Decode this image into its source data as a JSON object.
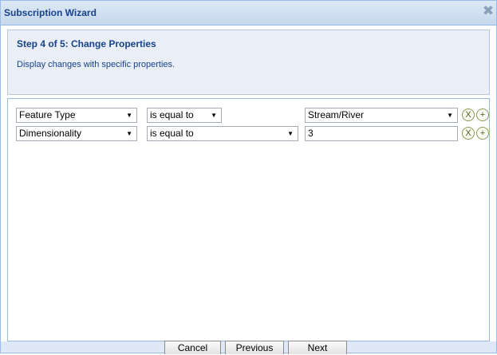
{
  "window": {
    "title": "Subscription Wizard",
    "close_icon": "✖"
  },
  "step": {
    "title": "Step 4 of 5: Change Properties",
    "description": "Display changes with specific properties."
  },
  "rows": [
    {
      "property": "Feature Type",
      "operator": "is equal to",
      "value": "Stream/River",
      "value_is_dropdown": true,
      "remove_label": "X",
      "add_label": "+"
    },
    {
      "property": "Dimensionality",
      "operator": "is equal to",
      "value": "3",
      "value_is_dropdown": false,
      "remove_label": "X",
      "add_label": "+"
    }
  ],
  "buttons": {
    "cancel": "Cancel",
    "previous": "Previous",
    "next": "Next"
  },
  "colors": {
    "title_text": "#15428b",
    "header_panel_bg": "#eaeef6",
    "border": "#99bbe8"
  }
}
